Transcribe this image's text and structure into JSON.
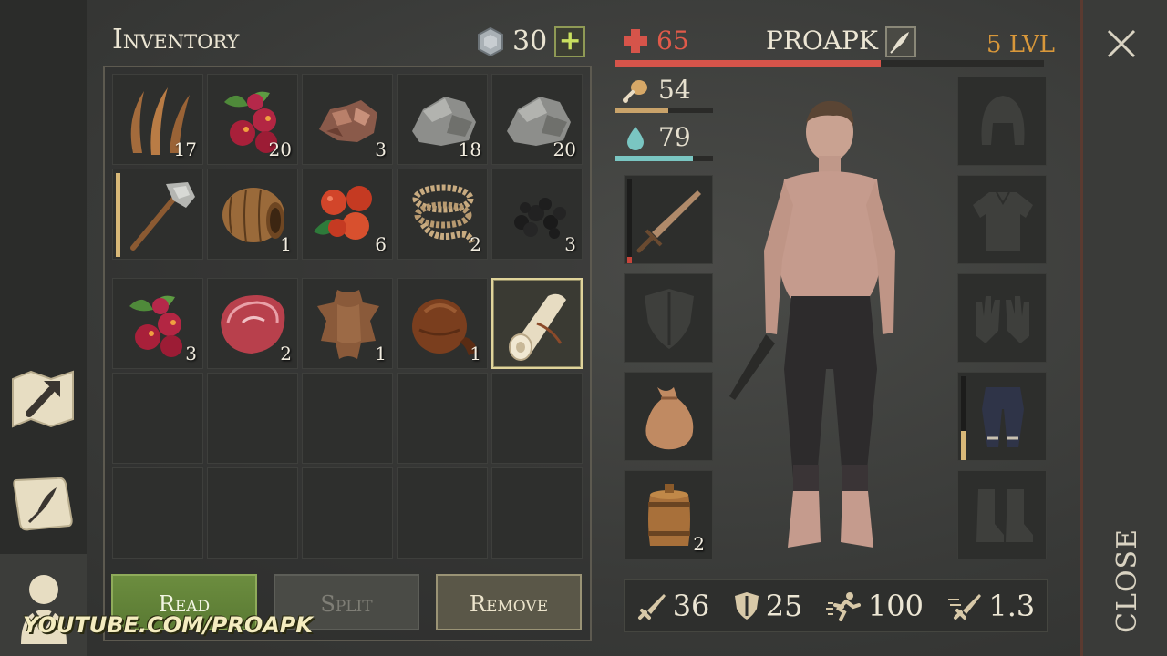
{
  "inventory": {
    "title": "Inventory",
    "coins": "30",
    "plus_label": "+",
    "slots": [
      {
        "name": "plant-fiber",
        "count": "17"
      },
      {
        "name": "berries",
        "count": "20"
      },
      {
        "name": "copper-ore",
        "count": "3"
      },
      {
        "name": "stone",
        "count": "18"
      },
      {
        "name": "stone",
        "count": "20"
      },
      {
        "name": "stone-axe",
        "count": "",
        "durability": 1.0
      },
      {
        "name": "barrel",
        "count": "1"
      },
      {
        "name": "rose-hips",
        "count": "6"
      },
      {
        "name": "rope",
        "count": "2"
      },
      {
        "name": "coal",
        "count": "3"
      },
      {
        "name": "berries",
        "count": "3"
      },
      {
        "name": "raw-meat",
        "count": "2"
      },
      {
        "name": "leather",
        "count": "1"
      },
      {
        "name": "water-flask",
        "count": "1"
      },
      {
        "name": "scroll",
        "count": "",
        "selected": true
      }
    ],
    "buttons": {
      "read": "Read",
      "split": "Split",
      "remove": "Remove"
    }
  },
  "watermark": "YOUTUBE.COM/PROAPK",
  "player": {
    "name": "PROAPK",
    "level": "5 LVL",
    "health": "65",
    "health_fraction": 0.62,
    "food": "54",
    "food_fraction": 0.54,
    "water": "79",
    "water_fraction": 0.79
  },
  "equipment": {
    "left": [
      {
        "name": "sword",
        "count": "",
        "durability": 0.08
      },
      {
        "name": "shield-empty",
        "count": ""
      },
      {
        "name": "sack",
        "count": ""
      },
      {
        "name": "keg",
        "count": "2"
      }
    ],
    "right": [
      {
        "name": "helmet-empty"
      },
      {
        "name": "chest-empty"
      },
      {
        "name": "gloves-empty"
      },
      {
        "name": "pants",
        "durability": 0.35
      },
      {
        "name": "boots-empty"
      }
    ]
  },
  "stats": {
    "attack": "36",
    "defense": "25",
    "speed": "100",
    "attack_speed": "1.3"
  },
  "close_label": "CLOSE",
  "colors": {
    "health": "#d6544a",
    "food": "#c9a36a",
    "water": "#7ac6c2",
    "level": "#d8973a"
  }
}
